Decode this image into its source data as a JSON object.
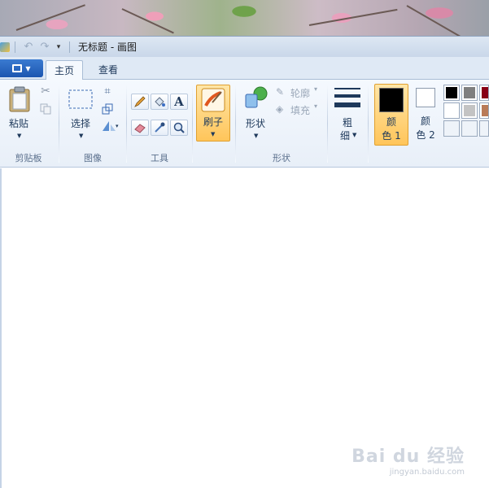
{
  "window": {
    "title": "无标题 - 画图"
  },
  "tabs": [
    {
      "label": "主页",
      "active": true
    },
    {
      "label": "查看",
      "active": false
    }
  ],
  "groups": {
    "clipboard": {
      "label": "剪贴板",
      "paste_label": "粘贴"
    },
    "image": {
      "label": "图像",
      "select_label": "选择"
    },
    "tools": {
      "label": "工具"
    },
    "brushes": {
      "label": "刷子"
    },
    "shapes": {
      "label": "形状",
      "shapes_label": "形状",
      "outline_label": "轮廓",
      "fill_label": "填充"
    },
    "size": {
      "label_line1": "粗",
      "label_line2": "细"
    },
    "colors": {
      "color1_line1": "颜",
      "color1_line2": "色 1",
      "color2_line1": "颜",
      "color2_line2": "色 2",
      "color1_value": "#000000",
      "color2_value": "#ffffff",
      "palette": [
        "#000000",
        "#7f7f7f",
        "#880015",
        "#ffffff",
        "#c3c3c3",
        "#b97a57",
        "",
        "",
        ""
      ]
    }
  },
  "icons": {
    "app_menu": "document-icon",
    "undo": "undo-icon",
    "redo": "redo-icon"
  },
  "watermark": {
    "logo": "Bai du 经验",
    "url": "jingyan.baidu.com"
  }
}
